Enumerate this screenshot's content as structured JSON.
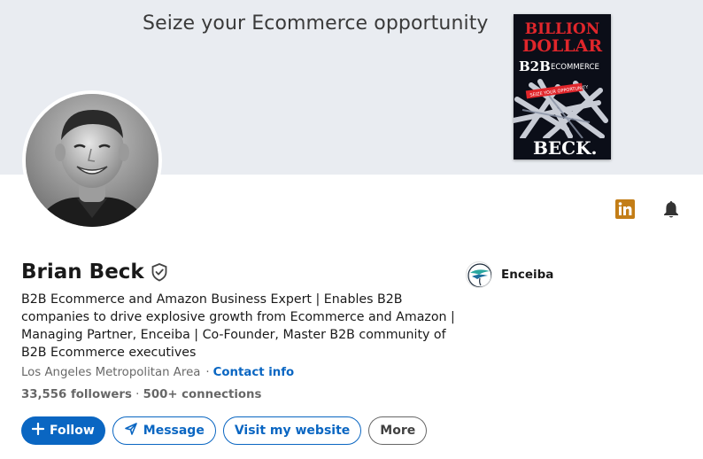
{
  "banner": {
    "text": "Seize your Ecommerce opportunity",
    "book": {
      "line1": "BILLION",
      "line2": "DOLLAR",
      "b2b": "B2B",
      "subtitle": "ECOMMERCE",
      "tag": "SEIZE YOUR OPPORTUNITY",
      "author": "BECK."
    }
  },
  "header_icons": [
    "linkedin-icon",
    "bell-icon"
  ],
  "profile": {
    "name": "Brian Beck",
    "headline": "B2B Ecommerce and Amazon Business Expert | Enables B2B companies to drive explosive growth from Ecommerce and Amazon | Managing Partner, Enceiba | Co-Founder, Master B2B community of B2B Ecommerce executives",
    "location": "Los Angeles Metropolitan Area",
    "separator": "·",
    "contact_label": "Contact info",
    "followers": "33,556 followers",
    "stat_separator": "·",
    "connections": "500+ connections"
  },
  "company": {
    "name": "Enceiba"
  },
  "actions": {
    "follow_label": "Follow",
    "message_label": "Message",
    "website_label": "Visit my website",
    "more_label": "More"
  },
  "colors": {
    "accent": "#0a66c2",
    "linkedin_icon": "#c37d16",
    "banner_bg": "#e9ecf1",
    "book_red": "#e0262b"
  }
}
